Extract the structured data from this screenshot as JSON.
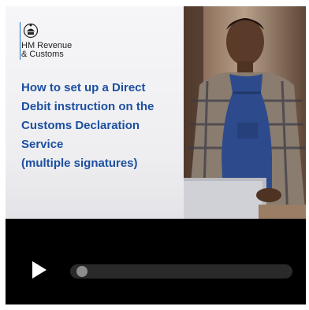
{
  "video": {
    "brand_line1": "HM Revenue",
    "brand_line2": "& Customs",
    "title_lines": [
      "How to set up a Direct",
      "Debit instruction on the",
      "Customs Declaration",
      "Service",
      "(multiple signatures)"
    ],
    "accent_color": "#1d4fa0"
  },
  "controls": {
    "play_icon": "play-icon",
    "progress": 0.0
  }
}
